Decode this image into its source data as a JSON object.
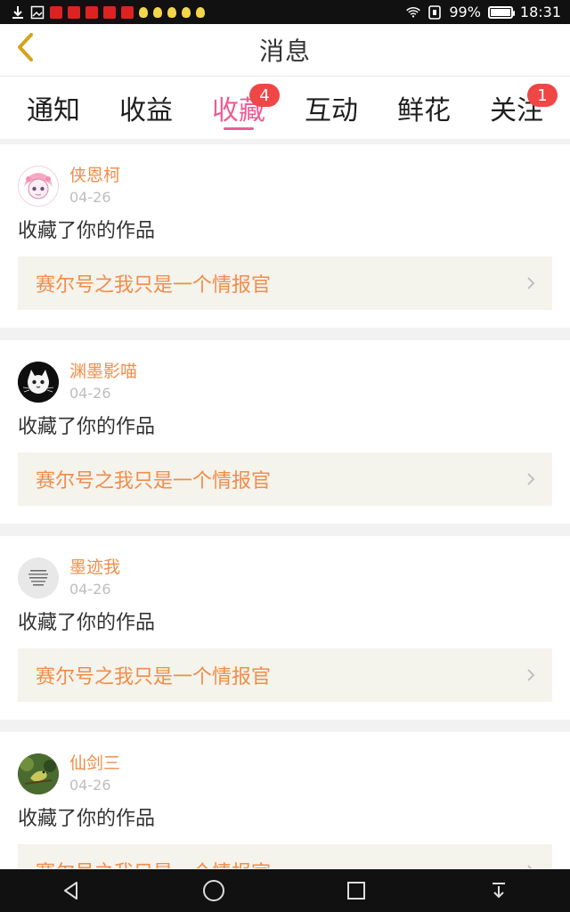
{
  "status_bar": {
    "battery": "99%",
    "time": "18:31",
    "battery_level": 0.99
  },
  "header": {
    "title": "消息"
  },
  "tabs": [
    {
      "label": "通知",
      "badge": null
    },
    {
      "label": "收益",
      "badge": null
    },
    {
      "label": "收藏",
      "badge": "4",
      "active": true
    },
    {
      "label": "互动",
      "badge": null
    },
    {
      "label": "鲜花",
      "badge": null
    },
    {
      "label": "关注",
      "badge": "1"
    }
  ],
  "feed": {
    "items": [
      {
        "user": "侠恩柯",
        "date": "04-26",
        "action": "收藏了你的作品",
        "work": "赛尔号之我只是一个情报官",
        "avatar_icon": "anime-girl-avatar"
      },
      {
        "user": "渊墨影喵",
        "date": "04-26",
        "action": "收藏了你的作品",
        "work": "赛尔号之我只是一个情报官",
        "avatar_icon": "cat-avatar"
      },
      {
        "user": "墨迹我",
        "date": "04-26",
        "action": "收藏了你的作品",
        "work": "赛尔号之我只是一个情报官",
        "avatar_icon": "text-avatar"
      },
      {
        "user": "仙剑三",
        "date": "04-26",
        "action": "收藏了你的作品",
        "work": "赛尔号之我只是一个情报官",
        "avatar_icon": "bird-avatar"
      }
    ]
  },
  "colors": {
    "accent": "#ec5d93",
    "name": "#f08d4a",
    "badge": "#f14646"
  }
}
